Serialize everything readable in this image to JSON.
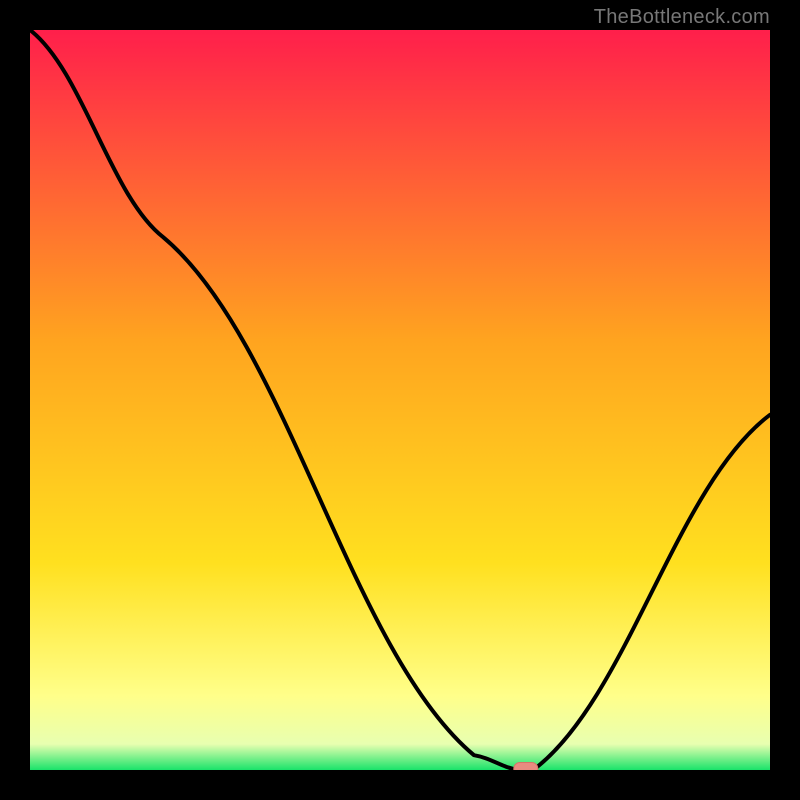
{
  "watermark": "TheBottleneck.com",
  "colors": {
    "black": "#000000",
    "curve": "#000000",
    "marker_fill": "#e98b80",
    "marker_stroke": "#d77368"
  },
  "chart_data": {
    "type": "line",
    "title": "",
    "xlabel": "",
    "ylabel": "",
    "xlim": [
      0,
      100
    ],
    "ylim": [
      0,
      100
    ],
    "x": [
      0,
      18,
      60,
      66,
      68,
      100
    ],
    "values": [
      100,
      72,
      2,
      0,
      0,
      48
    ],
    "marker": {
      "x": 67,
      "y": 0,
      "shape": "rounded-rect"
    },
    "gradient_stops": [
      {
        "offset": 0.0,
        "color": "#ff1f4b"
      },
      {
        "offset": 0.42,
        "color": "#ffa41f"
      },
      {
        "offset": 0.72,
        "color": "#ffe01f"
      },
      {
        "offset": 0.9,
        "color": "#ffff8a"
      },
      {
        "offset": 0.965,
        "color": "#e8ffb0"
      },
      {
        "offset": 1.0,
        "color": "#19e36a"
      }
    ]
  }
}
